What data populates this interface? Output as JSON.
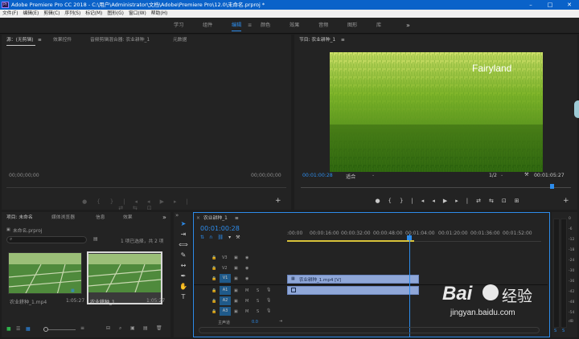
{
  "app": {
    "title": "Adobe Premiere Pro CC 2018 - C:\\用户\\Administrator\\文档\\Adobe\\Premiere Pro\\12.0\\未命名.prproj *",
    "logo": "Pr",
    "accent": "#2d8ceb",
    "title_bar_color": "#0a62c9"
  },
  "menu": [
    "文件(F)",
    "编辑(E)",
    "剪辑(C)",
    "序列(S)",
    "标记(M)",
    "图形(G)",
    "窗口(W)",
    "帮助(H)"
  ],
  "workspaces": {
    "items": [
      "学习",
      "组件",
      "编辑",
      "颜色",
      "效果",
      "音频",
      "图形",
      "库"
    ],
    "active": "编辑",
    "menu_glyph": "≡",
    "more_glyph": "»"
  },
  "source_panel": {
    "tabs": [
      "源：(无剪辑)",
      "效果控件",
      "音频剪辑混合器: 农业耕种_1",
      "元数据"
    ],
    "menu_glyph": "≡",
    "timecode_left": "00;00;00;00",
    "timecode_right": "00;00;00;00"
  },
  "program_panel": {
    "title": "节目: 农业耕种_1",
    "menu_glyph": "≡",
    "overlay_text": "Fairyland",
    "timecode": "00:01:00:28",
    "fit": "适合",
    "resolution": "1/2",
    "duration": "00:01:05:27"
  },
  "project_panel": {
    "tabs": [
      "项目: 未命名",
      "媒体浏览器",
      "信息",
      "效果"
    ],
    "more_glyph": "»",
    "file": "未命名.prproj",
    "selection_status": "1 项已选择，共 2 项",
    "items": [
      {
        "name": "农业耕种_1.mp4",
        "duration": "1:05:27"
      },
      {
        "name": "农业耕种_1",
        "duration": "1:05:27"
      }
    ]
  },
  "timeline": {
    "tab": "农业耕种_1",
    "close_glyph": "×",
    "menu_glyph": "≡",
    "timecode": "00:01:00:28",
    "ruler": [
      ":00:00",
      "00:00:16:00",
      "00:00:32:00",
      "00:00:48:00",
      "00:01:04:00",
      "00:01:20:00",
      "00:01:36:00",
      "00:01:52:00"
    ],
    "video_tracks": [
      "V3",
      "V2",
      "V1"
    ],
    "audio_tracks": [
      "A1",
      "A2",
      "A3"
    ],
    "master": {
      "label": "主声道",
      "value": "0.0"
    },
    "track_buttons": {
      "mute": "M",
      "solo": "S"
    },
    "clip_name": "农业耕种_1.mp4 [V]",
    "meter_labels": [
      "0",
      "-6",
      "-12",
      "-18",
      "-24",
      "-30",
      "-36",
      "-42",
      "-48",
      "-54",
      "dB"
    ],
    "solo_buttons": [
      "S",
      "S"
    ]
  },
  "watermark": {
    "brand": "Bai",
    "brand2": "经验",
    "url": "jingyan.baidu.com"
  }
}
